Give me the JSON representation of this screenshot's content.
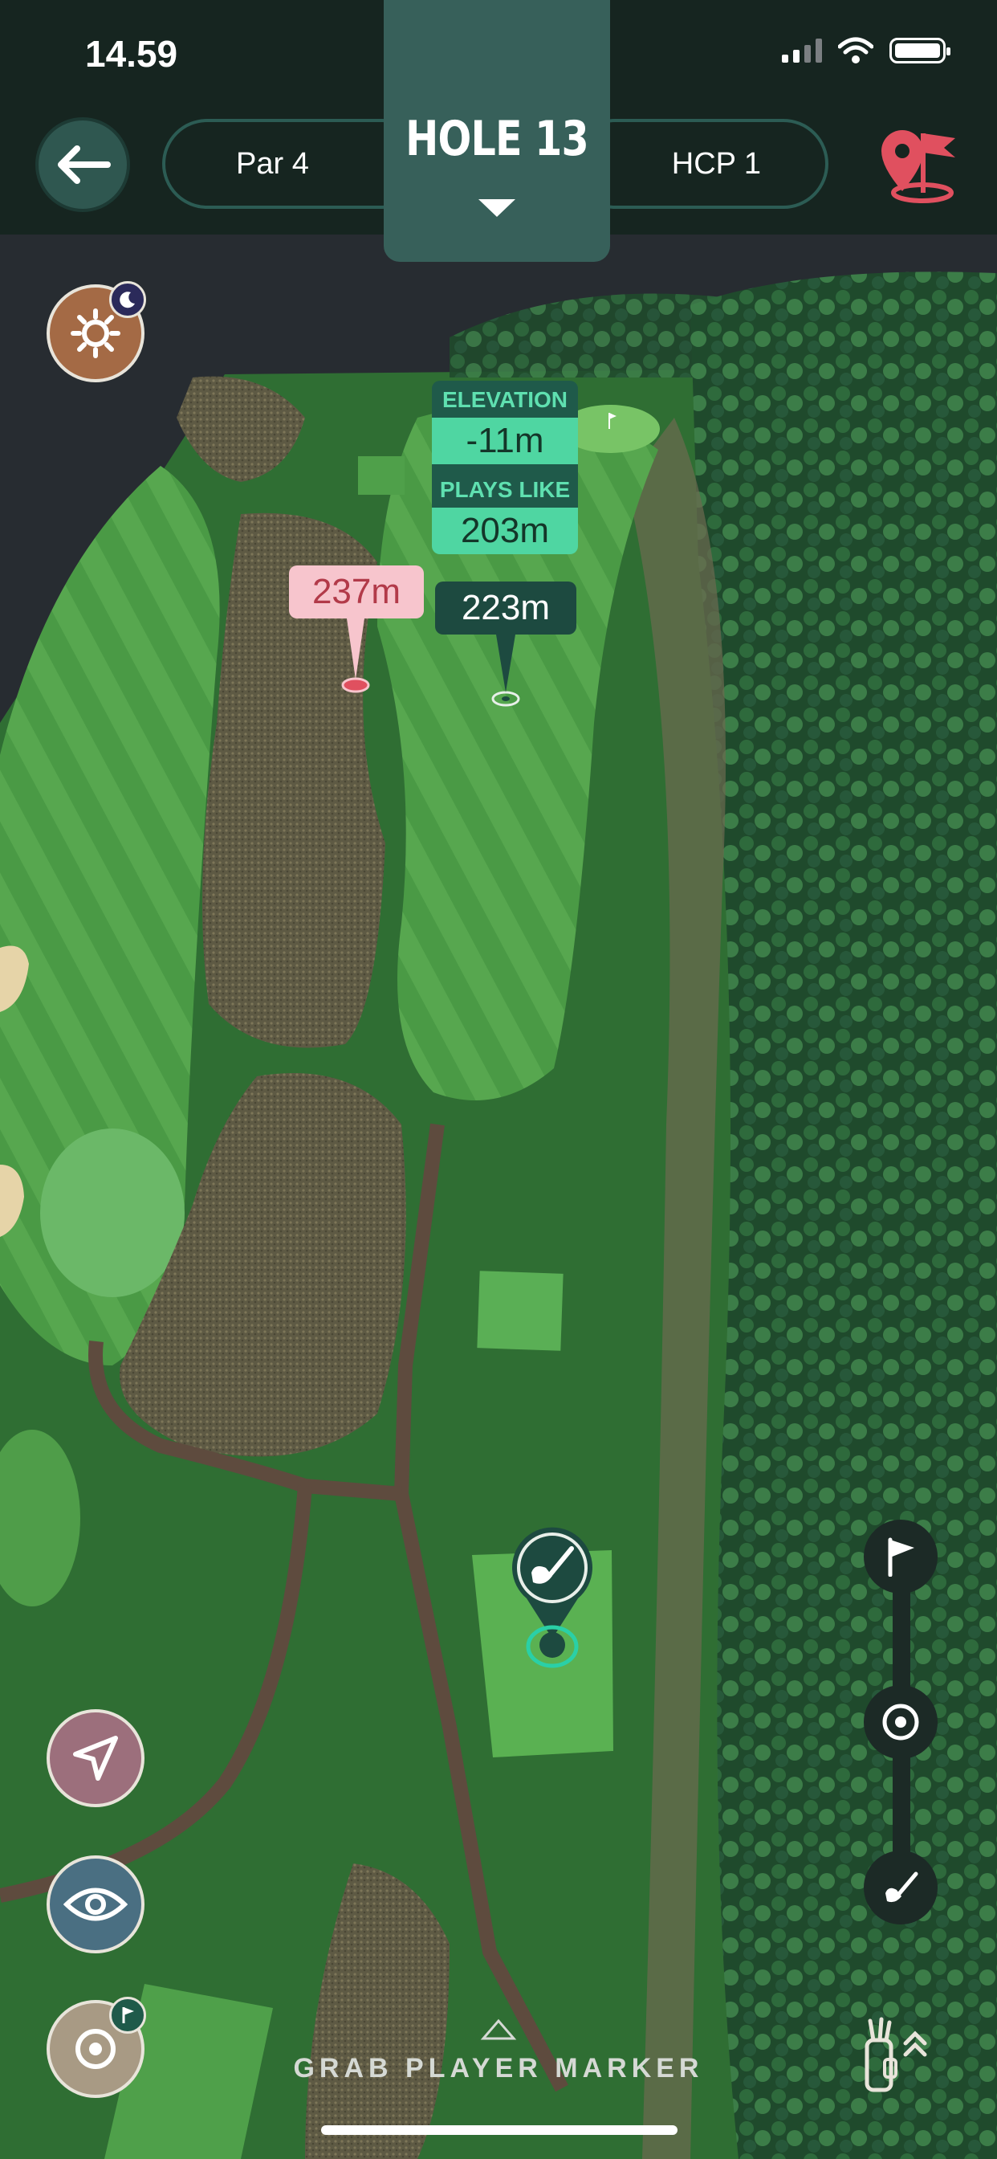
{
  "status_bar": {
    "time": "14.59"
  },
  "header": {
    "par": "Par 4",
    "hole": "HOLE 13",
    "hcp": "HCP 1"
  },
  "map": {
    "elevation_label": "ELEVATION",
    "elevation_value": "-11m",
    "plays_like_label": "PLAYS LIKE",
    "plays_like_value": "203m",
    "target_distance": "223m",
    "alt_distance": "237m"
  },
  "footer": {
    "grab_label": "GRAB PLAYER MARKER"
  },
  "icons": [
    "back-arrow-icon",
    "map-pin-flag-icon",
    "sun-icon",
    "moon-icon",
    "navigation-arrow-icon",
    "eye-icon",
    "target-icon",
    "flag-icon",
    "golf-club-icon",
    "golf-bag-icon",
    "double-chevron-up-icon",
    "caret-down-icon",
    "caret-up-icon"
  ],
  "colors": {
    "header_bg": "#162520",
    "hole_tab": "#37605a",
    "accent_green": "#4fd6a2",
    "accent_pink": "#f7c5cd",
    "pin_red": "#e0505f"
  }
}
